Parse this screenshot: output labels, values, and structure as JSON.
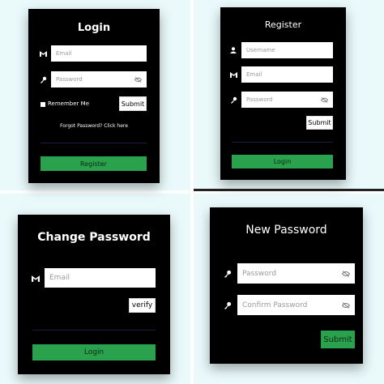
{
  "login": {
    "title": "Login",
    "email_placeholder": "Email",
    "password_placeholder": "Password",
    "remember_label": "Remember Me",
    "submit_label": "Submit",
    "forgot_text": "Forgot Password? Click here",
    "register_label": "Register"
  },
  "register": {
    "title": "Register",
    "username_placeholder": "Username",
    "email_placeholder": "Email",
    "password_placeholder": "Password",
    "submit_label": "Submit",
    "login_label": "Login"
  },
  "change_password": {
    "title": "Change Password",
    "email_placeholder": "Email",
    "verify_label": "verify",
    "login_label": "Login"
  },
  "new_password": {
    "title": "New Password",
    "password_placeholder": "Password",
    "confirm_placeholder": "Confirm Password",
    "submit_label": "Submit"
  },
  "colors": {
    "card_bg": "#000000",
    "page_bg": "#eafafb",
    "accent_green": "#2aa14d"
  },
  "icons": [
    "gmail-icon",
    "key-icon",
    "eye-slash-icon",
    "user-icon"
  ]
}
